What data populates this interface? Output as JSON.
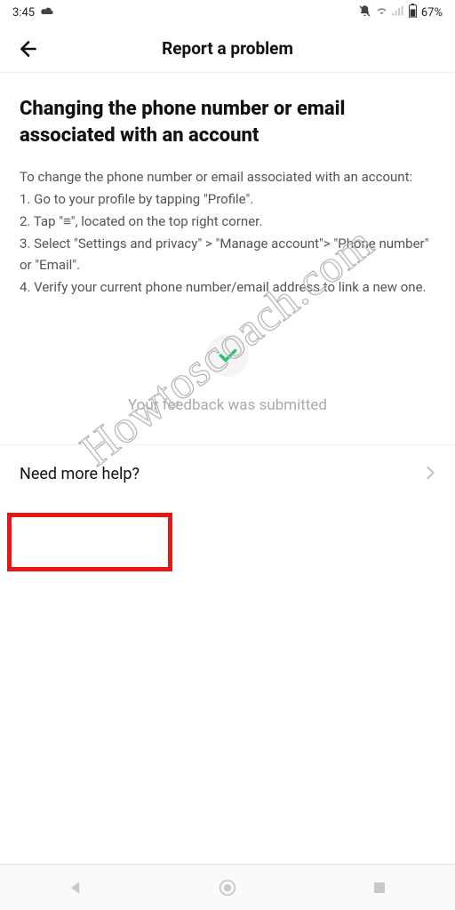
{
  "status_bar": {
    "time": "3:45",
    "battery_percent": "67%"
  },
  "header": {
    "title": "Report a problem"
  },
  "article": {
    "title": "Changing the phone number or email associated with an account",
    "intro": "To change the phone number or email associated with an account:",
    "steps": [
      "1. Go to your profile by tapping \"Profile\".",
      "2. Tap \"≡\", located on the top right corner.",
      "3. Select \"Settings and privacy\" > \"Manage account\"> \"Phone number\" or \"Email\".",
      "4. Verify your current phone number/email address to link a new one."
    ]
  },
  "feedback": {
    "submitted_text": "Your feedback was submitted"
  },
  "help": {
    "label": "Need more help?"
  },
  "watermark": {
    "text": "Howtoscoach.com"
  }
}
